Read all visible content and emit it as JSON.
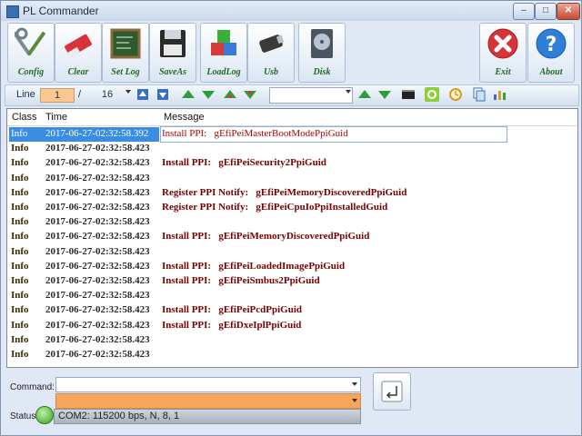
{
  "window": {
    "title": "PL Commander"
  },
  "toolbar": {
    "buttons": [
      {
        "label": "Config"
      },
      {
        "label": "Clear"
      },
      {
        "label": "Set Log"
      },
      {
        "label": "SaveAs"
      },
      {
        "label": "LoadLog"
      },
      {
        "label": "Usb"
      },
      {
        "label": "Disk"
      },
      {
        "label": "Exit"
      },
      {
        "label": "About"
      }
    ]
  },
  "nav": {
    "line_label": "Line",
    "line_value": "1",
    "separator": "/",
    "total": "16",
    "search_value": ""
  },
  "log": {
    "columns": [
      "Class",
      "Time",
      "Message"
    ],
    "rows": [
      {
        "class": "Info",
        "time": "2017-06-27-02:32:58.392",
        "message": "Install PPI:   gEfiPeiMasterBootModePpiGuid"
      },
      {
        "class": "Info",
        "time": "2017-06-27-02:32:58.423",
        "message": ""
      },
      {
        "class": "Info",
        "time": "2017-06-27-02:32:58.423",
        "message": "Install PPI:   gEfiPeiSecurity2PpiGuid"
      },
      {
        "class": "Info",
        "time": "2017-06-27-02:32:58.423",
        "message": ""
      },
      {
        "class": "Info",
        "time": "2017-06-27-02:32:58.423",
        "message": "Register PPI Notify:   gEfiPeiMemoryDiscoveredPpiGuid"
      },
      {
        "class": "Info",
        "time": "2017-06-27-02:32:58.423",
        "message": "Register PPI Notify:   gEfiPeiCpuIoPpiInstalledGuid"
      },
      {
        "class": "Info",
        "time": "2017-06-27-02:32:58.423",
        "message": ""
      },
      {
        "class": "Info",
        "time": "2017-06-27-02:32:58.423",
        "message": "Install PPI:   gEfiPeiMemoryDiscoveredPpiGuid"
      },
      {
        "class": "Info",
        "time": "2017-06-27-02:32:58.423",
        "message": ""
      },
      {
        "class": "Info",
        "time": "2017-06-27-02:32:58.423",
        "message": "Install PPI:   gEfiPeiLoadedImagePpiGuid"
      },
      {
        "class": "Info",
        "time": "2017-06-27-02:32:58.423",
        "message": "Install PPI:   gEfiPeiSmbus2PpiGuid"
      },
      {
        "class": "Info",
        "time": "2017-06-27-02:32:58.423",
        "message": ""
      },
      {
        "class": "Info",
        "time": "2017-06-27-02:32:58.423",
        "message": "Install PPI:   gEfiPeiPcdPpiGuid"
      },
      {
        "class": "Info",
        "time": "2017-06-27-02:32:58.423",
        "message": "Install PPI:   gEfiDxeIplPpiGuid"
      },
      {
        "class": "Info",
        "time": "2017-06-27-02:32:58.423",
        "message": ""
      },
      {
        "class": "Info",
        "time": "2017-06-27-02:32:58.423",
        "message": ""
      }
    ]
  },
  "command": {
    "label": "Command:",
    "value": ""
  },
  "status": {
    "label": "Status",
    "text": "COM2: 115200 bps, N, 8, 1"
  },
  "colors": {
    "accent": "#3a8de0",
    "line_field": "#fbc891",
    "command_field": "#f7a65a",
    "message_text": "#7a0000"
  }
}
